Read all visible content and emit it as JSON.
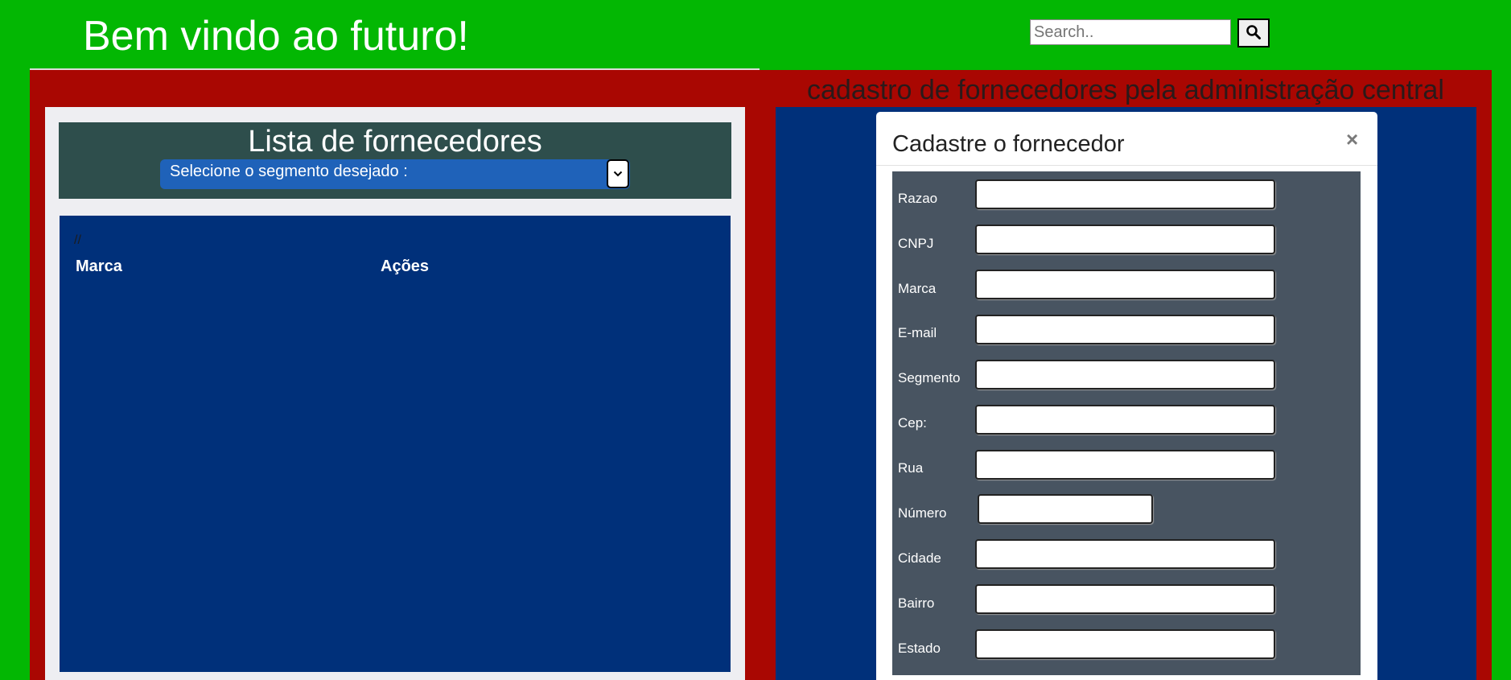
{
  "header": {
    "site_title": "Bem vindo ao futuro!",
    "search_placeholder": "Search..",
    "search_icon": "search-icon"
  },
  "right_title": "cadastro de fornecedores pela administração central",
  "list_panel": {
    "title": "Lista de fornecedores",
    "segment_select_label": "Selecione o segmento desejado :",
    "comment": "//",
    "columns": [
      "Marca",
      "Ações"
    ]
  },
  "modal": {
    "title": "Cadastre o fornecedor",
    "close_label": "×",
    "fields": [
      {
        "label": "Razao",
        "value": ""
      },
      {
        "label": "CNPJ",
        "value": ""
      },
      {
        "label": "Marca",
        "value": ""
      },
      {
        "label": "E-mail",
        "value": ""
      },
      {
        "label": "Segmento",
        "value": ""
      },
      {
        "label": "Cep:",
        "value": ""
      },
      {
        "label": "Rua",
        "value": ""
      },
      {
        "label": "Número",
        "value": ""
      },
      {
        "label": "Cidade",
        "value": ""
      },
      {
        "label": "Bairro",
        "value": ""
      },
      {
        "label": "Estado",
        "value": ""
      }
    ]
  },
  "colors": {
    "page_bg": "#03b703",
    "frame_red": "#a90702",
    "panel_blue": "#00307a",
    "header_teal": "#2e4e4c",
    "select_blue": "#1f62b9",
    "form_slate": "#485461"
  }
}
